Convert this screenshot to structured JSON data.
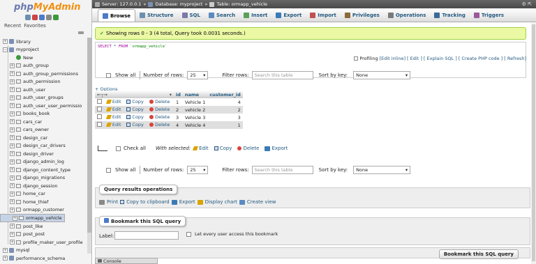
{
  "logo": {
    "php": "php",
    "my": "MyAdmin"
  },
  "nav": {
    "recent": "Recent",
    "favorites": "Favorites",
    "items": [
      {
        "label": "library",
        "type": "db"
      },
      {
        "label": "myproject",
        "type": "db",
        "expanded": true
      },
      {
        "label": "New",
        "type": "new"
      },
      {
        "label": "auth_group",
        "type": "table"
      },
      {
        "label": "auth_group_permissions",
        "type": "table"
      },
      {
        "label": "auth_permission",
        "type": "table"
      },
      {
        "label": "auth_user",
        "type": "table"
      },
      {
        "label": "auth_user_groups",
        "type": "table"
      },
      {
        "label": "auth_user_user_permissio",
        "type": "table"
      },
      {
        "label": "books_book",
        "type": "table"
      },
      {
        "label": "cars_car",
        "type": "table"
      },
      {
        "label": "cars_owner",
        "type": "table"
      },
      {
        "label": "design_car",
        "type": "table"
      },
      {
        "label": "design_car_drivers",
        "type": "table"
      },
      {
        "label": "design_driver",
        "type": "table"
      },
      {
        "label": "django_admin_log",
        "type": "table"
      },
      {
        "label": "django_content_type",
        "type": "table"
      },
      {
        "label": "django_migrations",
        "type": "table"
      },
      {
        "label": "django_session",
        "type": "table"
      },
      {
        "label": "home_car",
        "type": "table"
      },
      {
        "label": "home_thief",
        "type": "table"
      },
      {
        "label": "ormapp_customer",
        "type": "table"
      },
      {
        "label": "ormapp_vehicle",
        "type": "table",
        "selected": true
      },
      {
        "label": "post_like",
        "type": "table"
      },
      {
        "label": "post_post",
        "type": "table"
      },
      {
        "label": "profile_maker_user_profile",
        "type": "table"
      },
      {
        "label": "mysql",
        "type": "db"
      },
      {
        "label": "performance_schema",
        "type": "db"
      },
      {
        "label": "phpmyadmin",
        "type": "db"
      }
    ]
  },
  "breadcrumb": {
    "server": "Server: 127.0.0.1",
    "sep1": "»",
    "database": "Database: myproject",
    "sep2": "»",
    "table": "Table: ormapp_vehicle"
  },
  "tabs": [
    {
      "label": "Browse",
      "active": true,
      "color": "#4a7bc8"
    },
    {
      "label": "Structure",
      "color": "#6a8fb0"
    },
    {
      "label": "SQL",
      "color": "#7a7aaa"
    },
    {
      "label": "Search",
      "color": "#5a8ac0"
    },
    {
      "label": "Insert",
      "color": "#5aa05a"
    },
    {
      "label": "Export",
      "color": "#3a7ab8"
    },
    {
      "label": "Import",
      "color": "#c05050"
    },
    {
      "label": "Privileges",
      "color": "#8a6a3a"
    },
    {
      "label": "Operations",
      "color": "#7a7a7a"
    },
    {
      "label": "Tracking",
      "color": "#3a6a9a"
    },
    {
      "label": "Triggers",
      "color": "#9a5a9a"
    }
  ],
  "success": "Showing rows 0 - 3 (4 total, Query took 0.0031 seconds.)",
  "sql": {
    "kw1": "SELECT",
    "star": " * ",
    "kw2": "FROM",
    "table": " `ormapp_vehicle`"
  },
  "profiling": {
    "label": "Profiling",
    "links": "[Edit inline] [ Edit ] [ Explain SQL ] [ Create PHP code ] [ Refresh]"
  },
  "navbar": {
    "show_all": "Show all",
    "num_rows_label": "Number of rows:",
    "num_rows": "25",
    "filter_label": "Filter rows:",
    "filter_placeholder": "Search this table",
    "sort_label": "Sort by key:",
    "sort_value": "None"
  },
  "options": "+ Options",
  "table": {
    "headers": [
      "id",
      "name",
      "customer_id"
    ],
    "actions": {
      "edit": "Edit",
      "copy": "Copy",
      "delete": "Delete"
    },
    "rows": [
      [
        "1",
        "Vehicle 1",
        "4"
      ],
      [
        "2",
        "vehicle 2",
        "2"
      ],
      [
        "3",
        "Vehicle 3",
        "3"
      ],
      [
        "4",
        "Vehicle 4",
        "1"
      ]
    ]
  },
  "withsel": {
    "check_all": "Check all",
    "with_selected": "With selected:",
    "edit": "Edit",
    "copy": "Copy",
    "delete": "Delete",
    "export": "Export"
  },
  "qops": {
    "title": "Query results operations",
    "print": "Print",
    "copy": "Copy to clipboard",
    "export": "Export",
    "chart": "Display chart",
    "view": "Create view"
  },
  "bookmark": {
    "title": "Bookmark this SQL query",
    "label": "Label:",
    "every": "Let every user access this bookmark",
    "button": "Bookmark this SQL query"
  },
  "console": "Console"
}
